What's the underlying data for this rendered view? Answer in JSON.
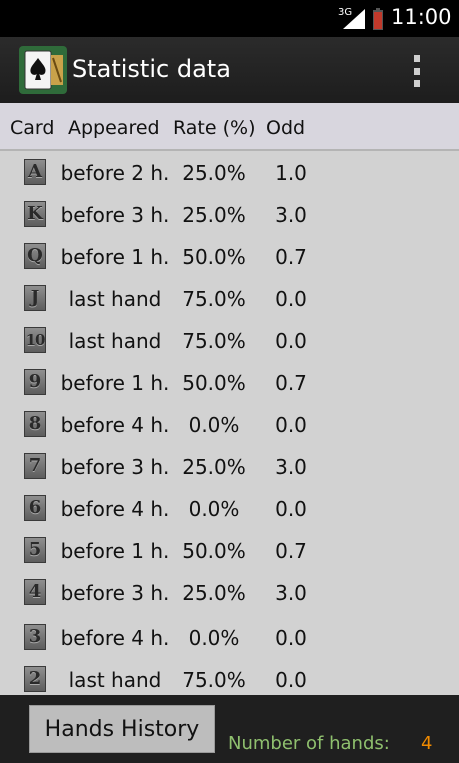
{
  "status_bar": {
    "network": "3G",
    "time": "11:00",
    "battery_color": "#c0392b"
  },
  "action_bar": {
    "title": "Statistic data",
    "app_icon": "ace-of-spades-icon",
    "overflow_icon": "overflow-menu-icon"
  },
  "table": {
    "headers": {
      "card": "Card",
      "appeared": "Appeared",
      "rate": "Rate (%)",
      "odd": "Odd"
    },
    "rows": [
      {
        "card": "A",
        "appeared": "before 2 h.",
        "rate": "25.0%",
        "odd": "1.0"
      },
      {
        "card": "K",
        "appeared": "before 3 h.",
        "rate": "25.0%",
        "odd": "3.0"
      },
      {
        "card": "Q",
        "appeared": "before 1 h.",
        "rate": "50.0%",
        "odd": "0.7"
      },
      {
        "card": "J",
        "appeared": "last hand",
        "rate": "75.0%",
        "odd": "0.0"
      },
      {
        "card": "10",
        "appeared": "last hand",
        "rate": "75.0%",
        "odd": "0.0"
      },
      {
        "card": "9",
        "appeared": "before 1 h.",
        "rate": "50.0%",
        "odd": "0.7"
      },
      {
        "card": "8",
        "appeared": "before 4 h.",
        "rate": "0.0%",
        "odd": "0.0"
      },
      {
        "card": "7",
        "appeared": "before 3 h.",
        "rate": "25.0%",
        "odd": "3.0"
      },
      {
        "card": "6",
        "appeared": "before 4 h.",
        "rate": "0.0%",
        "odd": "0.0"
      },
      {
        "card": "5",
        "appeared": "before 1 h.",
        "rate": "50.0%",
        "odd": "0.7"
      },
      {
        "card": "4",
        "appeared": "before 3 h.",
        "rate": "25.0%",
        "odd": "3.0"
      },
      {
        "card": "3",
        "appeared": "before 4 h.",
        "rate": "0.0%",
        "odd": "0.0"
      },
      {
        "card": "2",
        "appeared": "last hand",
        "rate": "75.0%",
        "odd": "0.0"
      }
    ]
  },
  "footer": {
    "hands_history_label": "Hands History",
    "number_of_hands_label": "Number of hands:",
    "number_of_hands_value": "4"
  }
}
